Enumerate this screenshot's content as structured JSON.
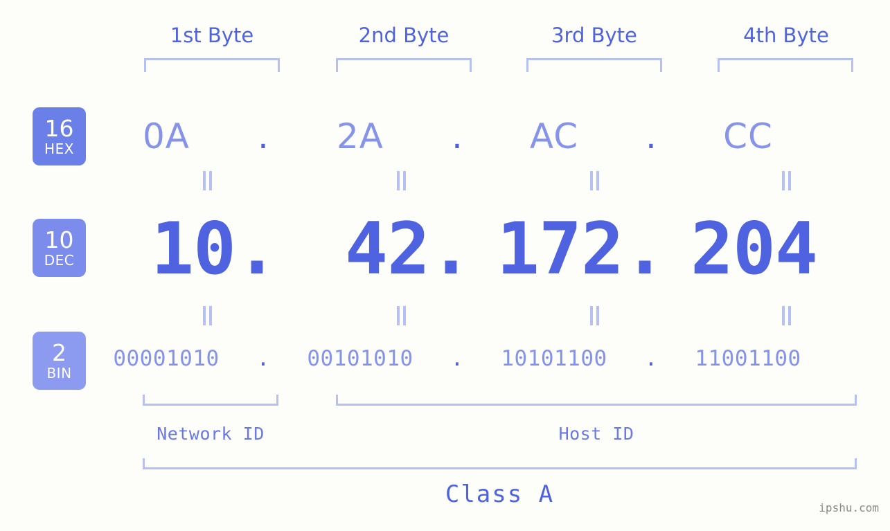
{
  "background_color": "#fdfdfa",
  "accent_color": "#4f63e0",
  "accent_light_color": "#8593ea",
  "bracket_color": "#b7c0f2",
  "byte_headers": [
    {
      "label": "1st Byte"
    },
    {
      "label": "2nd Byte"
    },
    {
      "label": "3rd Byte"
    },
    {
      "label": "4th Byte"
    }
  ],
  "rows": {
    "hex": {
      "base_number": "16",
      "base_name": "HEX",
      "badge_color": "#6b7fe8",
      "values": [
        "0A",
        "2A",
        "AC",
        "CC"
      ],
      "separator": "."
    },
    "dec": {
      "base_number": "10",
      "base_name": "DEC",
      "badge_color": "#7c8ced",
      "values": [
        "10",
        "42",
        "172",
        "204"
      ],
      "separator": "."
    },
    "bin": {
      "base_number": "2",
      "base_name": "BIN",
      "badge_color": "#8c9bf0",
      "values": [
        "00001010",
        "00101010",
        "10101100",
        "11001100"
      ],
      "separator": "."
    }
  },
  "equality_mark": "||",
  "footer": {
    "network_id_label": "Network ID",
    "host_id_label": "Host ID",
    "class_label": "Class A"
  },
  "watermark": "ipshu.com"
}
